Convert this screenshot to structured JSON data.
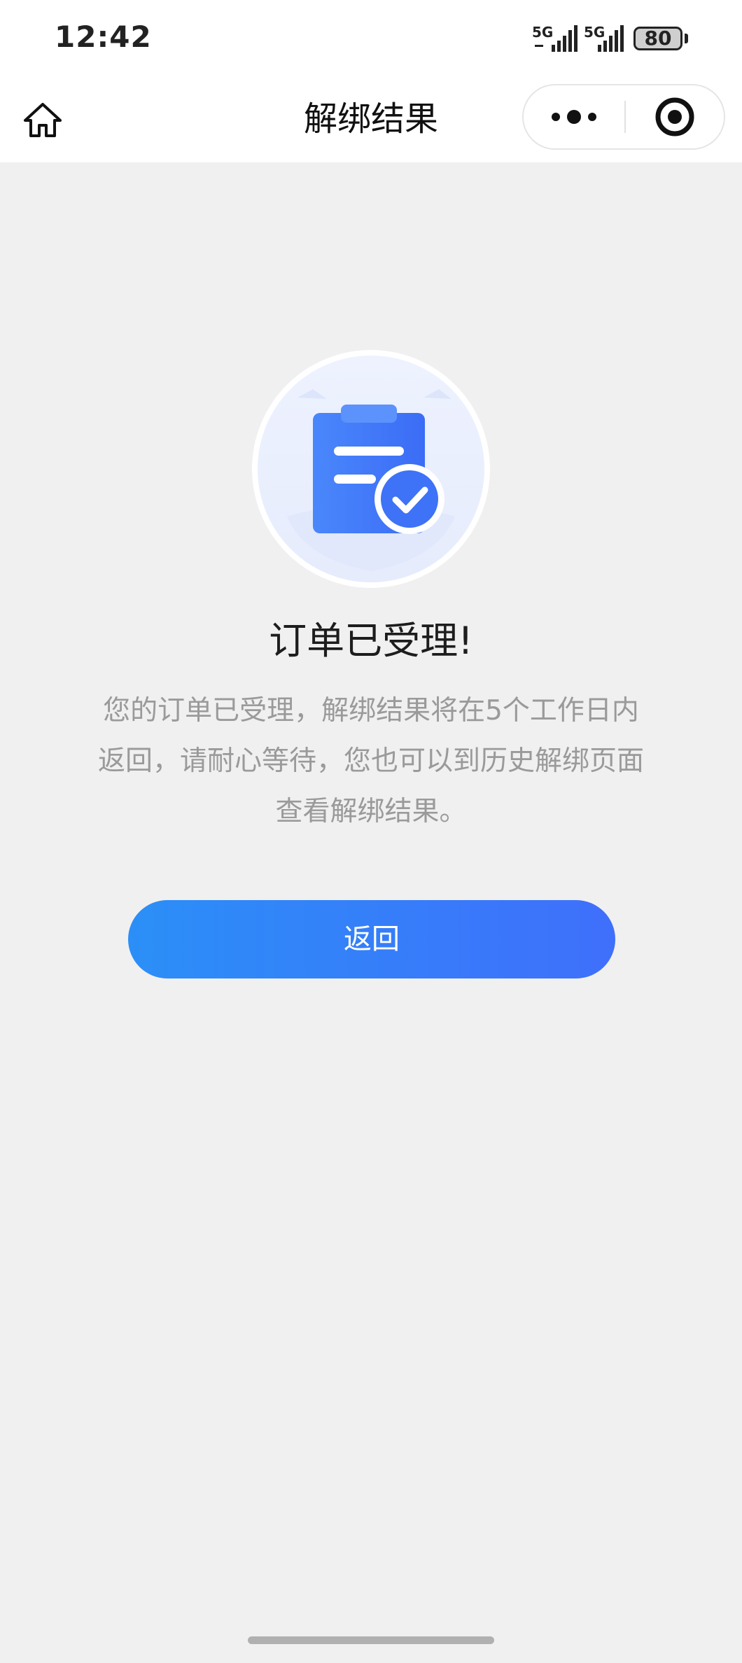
{
  "status_bar": {
    "time": "12:42",
    "signal_1_label": "5G",
    "signal_2_label": "5G",
    "battery_level": "80"
  },
  "nav": {
    "title": "解绑结果",
    "home_icon": "home-icon",
    "more_icon": "more-dots-icon",
    "close_icon": "target-close-icon"
  },
  "result": {
    "icon": "clipboard-check-icon",
    "title": "订单已受理!",
    "description": "您的订单已受理，解绑结果将在5个工作日内返回，请耐心等待，您也可以到历史解绑页面查看解绑结果。"
  },
  "actions": {
    "back_label": "返回"
  },
  "colors": {
    "page_background": "#f0f0f0",
    "button_gradient_start": "#2b8ff7",
    "button_gradient_end": "#3f6ffb",
    "illustration_blue": "#4a7dfb"
  }
}
